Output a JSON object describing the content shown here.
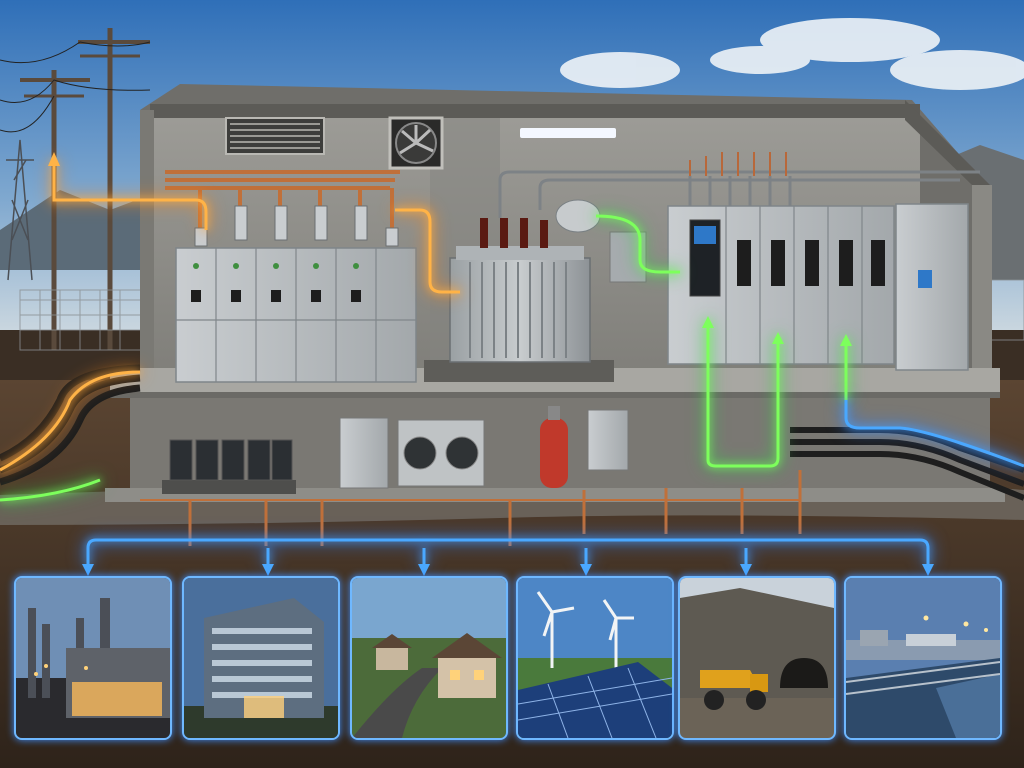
{
  "colors": {
    "sky_top": "#2f6fb8",
    "sky_bottom": "#a9c7e0",
    "soil": "#4a3726",
    "concrete": "#8d8c88",
    "cabinet": "#b7bcbf",
    "flow_blue": "#4aa8ff",
    "flow_green": "#7dff5c",
    "flow_orange": "#ffb347",
    "copper": "#c0703a"
  },
  "scene": {
    "building": "prefabricated-substation-enclosure",
    "components": [
      "utility-power-pole",
      "lattice-transmission-tower",
      "ventilation-louver",
      "exhaust-fan",
      "ceiling-light",
      "medium-voltage-switchgear",
      "power-transformer",
      "low-voltage-switchboard",
      "control-panel",
      "battery-bank",
      "hvac-units",
      "fire-suppression-cylinder",
      "grounding-rods",
      "underground-cables"
    ]
  },
  "destinations": [
    {
      "id": "industrial-plant",
      "icon": "factory-icon"
    },
    {
      "id": "office-building",
      "icon": "building-icon"
    },
    {
      "id": "residential-neighborhood",
      "icon": "house-icon"
    },
    {
      "id": "renewable-energy-farm",
      "icon": "wind-solar-icon"
    },
    {
      "id": "mining-site",
      "icon": "mining-truck-icon"
    },
    {
      "id": "water-treatment-plant",
      "icon": "water-plant-icon"
    }
  ]
}
